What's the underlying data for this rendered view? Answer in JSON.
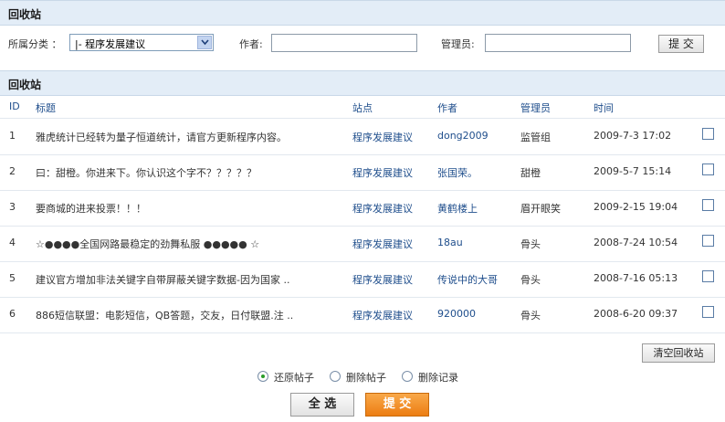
{
  "top_section": {
    "title": "回收站"
  },
  "filter": {
    "category_label": "所属分类 ：",
    "category_value": "|- 程序发展建议",
    "author_label": "作者:",
    "author_value": "",
    "admin_label": "管理员:",
    "admin_value": "",
    "submit_label": "提 交"
  },
  "list_section": {
    "title": "回收站"
  },
  "table": {
    "headers": {
      "id": "ID",
      "title": "标题",
      "site": "站点",
      "author": "作者",
      "admin": "管理员",
      "time": "时间"
    },
    "rows": [
      {
        "id": "1",
        "title": "雅虎统计已经转为量子恒道统计，请官方更新程序内容。",
        "site": "程序发展建议",
        "author": "dong2009",
        "admin": "监管组",
        "time": "2009-7-3 17:02"
      },
      {
        "id": "2",
        "title": "曰：甜橙。你进来下。你认识这个字不？？？？？",
        "site": "程序发展建议",
        "author": "张国荣。",
        "admin": "甜橙",
        "time": "2009-5-7 15:14"
      },
      {
        "id": "3",
        "title": "要商城的进来投票！！！",
        "site": "程序发展建议",
        "author": "黄鹤楼上",
        "admin": "眉开眼笑",
        "time": "2009-2-15 19:04"
      },
      {
        "id": "4",
        "title": "☆●●●●全国网路最稳定的劲舞私服 ●●●●● ☆",
        "site": "程序发展建议",
        "author": "18au",
        "admin": "骨头",
        "time": "2008-7-24 10:54"
      },
      {
        "id": "5",
        "title": "建议官方增加非法关键字自带屏蔽关键字数据-因为国家 ..",
        "site": "程序发展建议",
        "author": "传说中的大哥",
        "admin": "骨头",
        "time": "2008-7-16 05:13"
      },
      {
        "id": "6",
        "title": "886短信联盟：电影短信，QB答题，交友，日付联盟.注 ..",
        "site": "程序发展建议",
        "author": "920000",
        "admin": "骨头",
        "time": "2008-6-20 09:37"
      }
    ]
  },
  "actions": {
    "clear_label": "清空回收站",
    "options": [
      "还原帖子",
      "删除帖子",
      "删除记录"
    ],
    "selected_option": "还原帖子",
    "select_all_label": "全 选",
    "submit_label": "提 交"
  },
  "colors": {
    "header_bg": "#e3edf7",
    "link": "#1f4e8c",
    "accent_button": "#f08a1c"
  }
}
